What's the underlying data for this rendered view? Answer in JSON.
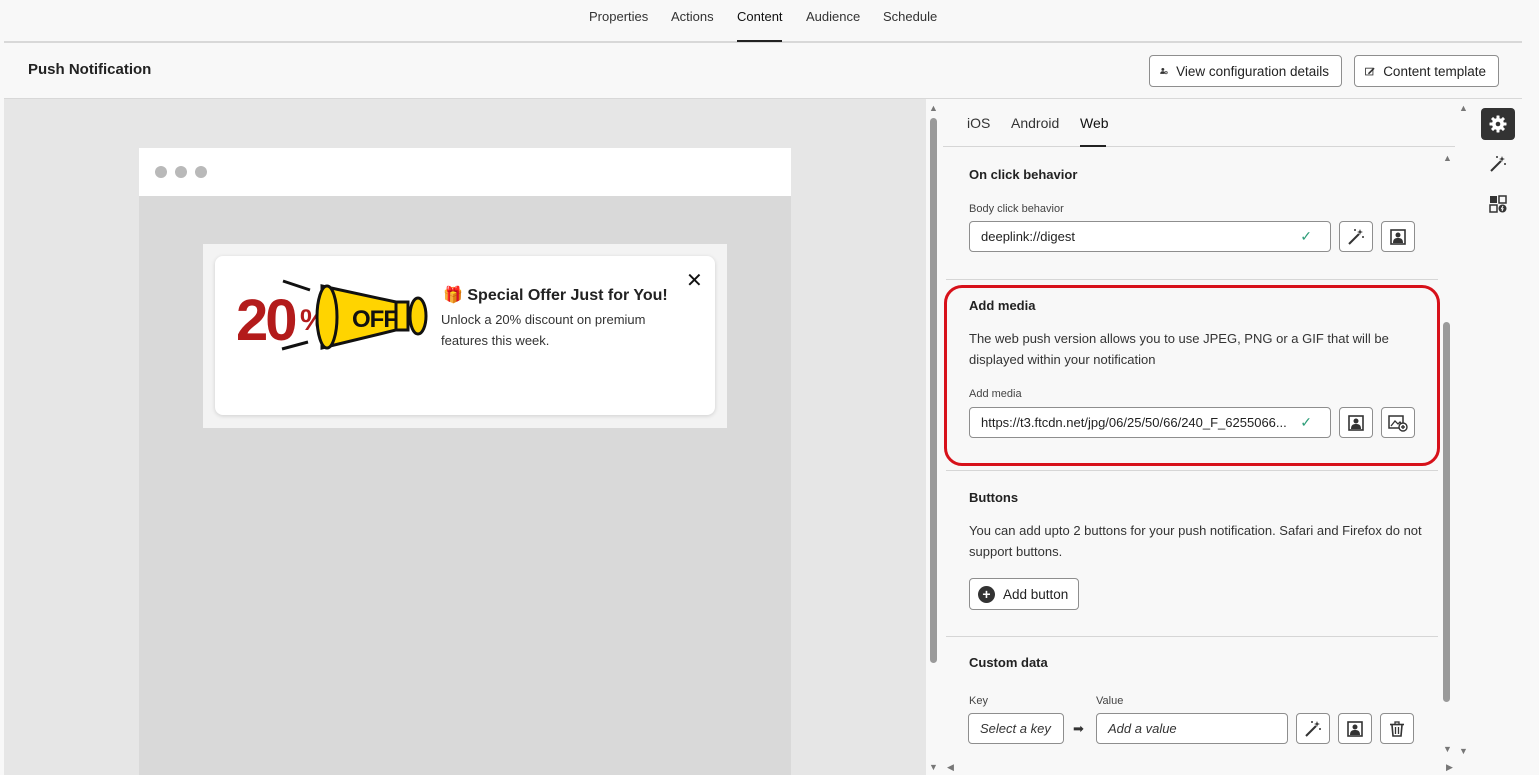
{
  "top_tabs": [
    "Properties",
    "Actions",
    "Content",
    "Audience",
    "Schedule"
  ],
  "header": {
    "title": "Push Notification",
    "view_config_label": "View configuration details",
    "content_template_label": "Content template"
  },
  "preview": {
    "notification": {
      "title": "🎁 Special Offer Just for You!",
      "body": "Unlock a 20% discount on premium features this week.",
      "image_text_big": "20",
      "image_text_pct": "%",
      "image_text_off": "OFF"
    }
  },
  "platform_tabs": [
    "iOS",
    "Android",
    "Web"
  ],
  "active_platform": "Web",
  "on_click": {
    "title": "On click behavior",
    "field_label": "Body click behavior",
    "value": "deeplink://digest"
  },
  "add_media": {
    "title": "Add media",
    "description": "The web push version allows you to use JPEG, PNG or a GIF that will be displayed within your notification",
    "field_label": "Add media",
    "value": "https://t3.ftcdn.net/jpg/06/25/50/66/240_F_6255066..."
  },
  "buttons": {
    "title": "Buttons",
    "description": "You can add upto 2 buttons for your push notification. Safari and Firefox do not support buttons.",
    "add_label": "Add button"
  },
  "custom_data": {
    "title": "Custom data",
    "key_label": "Key",
    "value_label": "Value",
    "key_placeholder": "Select a key",
    "value_placeholder": "Add a value"
  },
  "colors": {
    "highlight": "#d7111a",
    "valid_check": "#2d9d78"
  }
}
